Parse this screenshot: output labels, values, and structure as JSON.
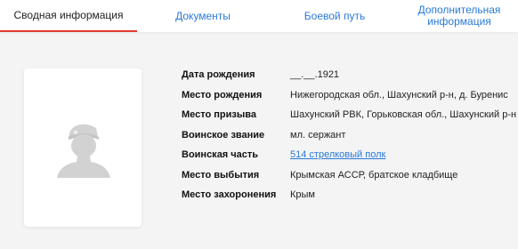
{
  "tabs": [
    {
      "label": "Сводная информация",
      "active": true
    },
    {
      "label": "Документы",
      "active": false
    },
    {
      "label": "Боевой путь",
      "active": false
    },
    {
      "label": "Дополнительная информация",
      "active": false
    }
  ],
  "tab_colors": {
    "accent": "#e23a2f",
    "link": "#2a7ad8"
  },
  "photo": {
    "icon": "soldier-avatar-placeholder-icon"
  },
  "info": {
    "birth_date": {
      "label": "Дата рождения",
      "value": "__.__.1921"
    },
    "birth_place": {
      "label": "Место рождения",
      "value": "Нижегородская обл., Шахунский р-н, д. Бурениc"
    },
    "conscription_place": {
      "label": "Место призыва",
      "value": "Шахунский РВК, Горьковская обл., Шахунский р-н"
    },
    "rank": {
      "label": "Воинское звание",
      "value": "мл. сержант"
    },
    "military_unit": {
      "label": "Воинская часть",
      "value": "514 стрелковый полк"
    },
    "departure_place": {
      "label": "Место выбытия",
      "value": "Крымская АССР, братское кладбище"
    },
    "burial_place": {
      "label": "Место захоронения",
      "value": "Крым"
    }
  }
}
